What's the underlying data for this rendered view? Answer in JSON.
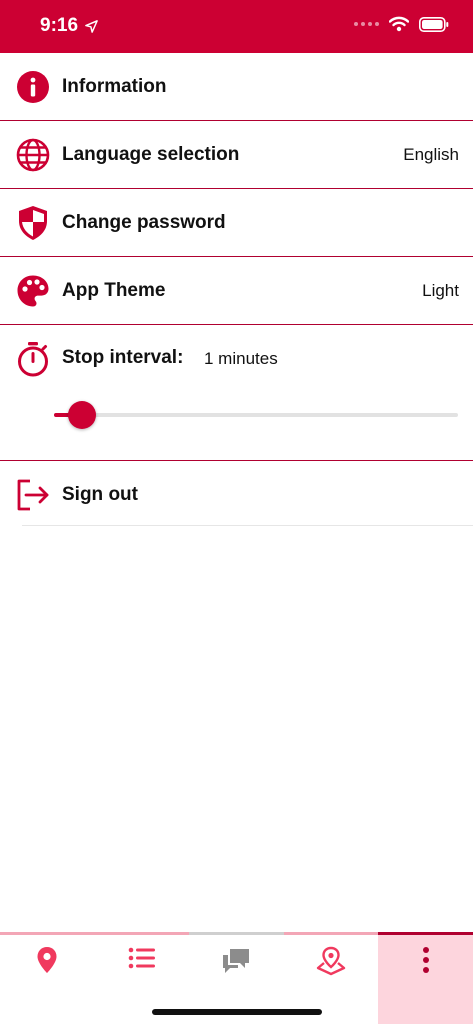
{
  "status_bar": {
    "time": "9:16"
  },
  "settings": {
    "information": {
      "label": "Information"
    },
    "language": {
      "label": "Language selection",
      "value": "English"
    },
    "password": {
      "label": "Change password"
    },
    "theme": {
      "label": "App Theme",
      "value": "Light"
    },
    "stop_interval": {
      "label": "Stop interval:",
      "value_text": "1 minutes",
      "slider_fraction": 0.07
    },
    "sign_out": {
      "label": "Sign out"
    }
  },
  "tab_bar": {
    "tabs": [
      {
        "icon": "map-pin-icon"
      },
      {
        "icon": "list-icon"
      },
      {
        "icon": "chat-icon"
      },
      {
        "icon": "route-pin-icon"
      },
      {
        "icon": "more-vertical-icon",
        "active": true
      }
    ]
  },
  "colors": {
    "accent": "#cc0033",
    "active_tab_bg": "#fdd5dd"
  }
}
